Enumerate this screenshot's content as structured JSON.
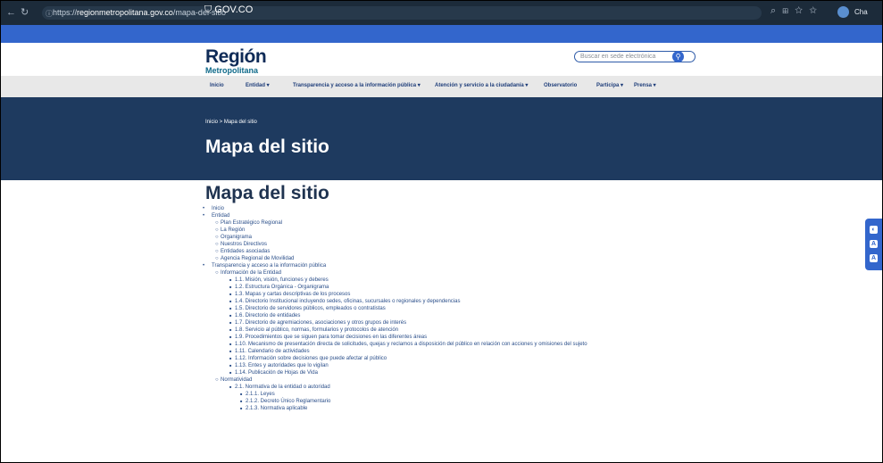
{
  "browser": {
    "url_prefix": "https://",
    "url_domain": "regionmetropolitana.gov.co",
    "url_path": "/mapa-del-sitio",
    "profile_label": "Cha"
  },
  "govbar": {
    "logo": "⛉ GOV.CO"
  },
  "header": {
    "logo_line1": "Región",
    "logo_line2": "Metropolitana",
    "search_placeholder": "Buscar en sede electrónica"
  },
  "nav": [
    "Inicio",
    "Entidad ▾",
    "Transparencia y acceso a la información pública ▾",
    "Atención y servicio a la ciudadanía ▾",
    "Observatorio",
    "Participa ▾",
    "Prensa ▾"
  ],
  "hero": {
    "breadcrumb": "Inicio > Mapa del sitio",
    "title": "Mapa del sitio"
  },
  "content": {
    "title": "Mapa del sitio",
    "tree": [
      {
        "level": 1,
        "text": "Inicio"
      },
      {
        "level": 1,
        "text": "Entidad"
      },
      {
        "level": 2,
        "text": "Plan Estratégico Regional"
      },
      {
        "level": 2,
        "text": "La Región"
      },
      {
        "level": 2,
        "text": "Organigrama"
      },
      {
        "level": 2,
        "text": "Nuestros Directivos"
      },
      {
        "level": 2,
        "text": "Entidades asociadas"
      },
      {
        "level": 2,
        "text": "Agencia Regional de Movilidad"
      },
      {
        "level": 1,
        "text": "Transparencia y acceso a la información pública"
      },
      {
        "level": 2,
        "text": "Información de la Entidad"
      },
      {
        "level": 3,
        "text": "1.1. Misión, visión, funciones y deberes"
      },
      {
        "level": 3,
        "text": "1.2. Estructura Orgánica - Organigrama"
      },
      {
        "level": 3,
        "text": "1.3. Mapas y cartas descriptivas de los procesos"
      },
      {
        "level": 3,
        "text": "1.4. Directorio Institucional incluyendo sedes, oficinas, sucursales o regionales y dependencias"
      },
      {
        "level": 3,
        "text": "1.5. Directorio de servidores públicos, empleados o contratistas"
      },
      {
        "level": 3,
        "text": "1.6. Directorio de entidades"
      },
      {
        "level": 3,
        "text": "1.7. Directorio de agremiaciones, asociaciones y otros grupos de interés"
      },
      {
        "level": 3,
        "text": "1.8. Servicio al público, normas, formularios y protocolos de atención"
      },
      {
        "level": 3,
        "text": "1.9. Procedimientos que se siguen para tomar decisiones en las diferentes áreas"
      },
      {
        "level": 3,
        "text": "1.10. Mecanismo de presentación directa de solicitudes, quejas y reclamos a disposición del público en relación con acciones y omisiones del sujeto"
      },
      {
        "level": 3,
        "text": "1.11. Calendario de actividades"
      },
      {
        "level": 3,
        "text": "1.12. Información sobre decisiones que puede afectar al público"
      },
      {
        "level": 3,
        "text": "1.13. Entes y autoridades que lo vigilan"
      },
      {
        "level": 3,
        "text": "1.14. Publicación de Hojas de Vida"
      },
      {
        "level": 2,
        "text": "Normatividad"
      },
      {
        "level": 3,
        "text": "2.1. Normativa de la entidad o autoridad"
      },
      {
        "level": 4,
        "text": "2.1.1. Leyes"
      },
      {
        "level": 4,
        "text": "2.1.2. Decreto Único Reglamentario"
      },
      {
        "level": 4,
        "text": "2.1.3. Normativa aplicable"
      }
    ]
  },
  "sidebar": {
    "buttons": [
      "◐",
      "A",
      "A"
    ]
  }
}
